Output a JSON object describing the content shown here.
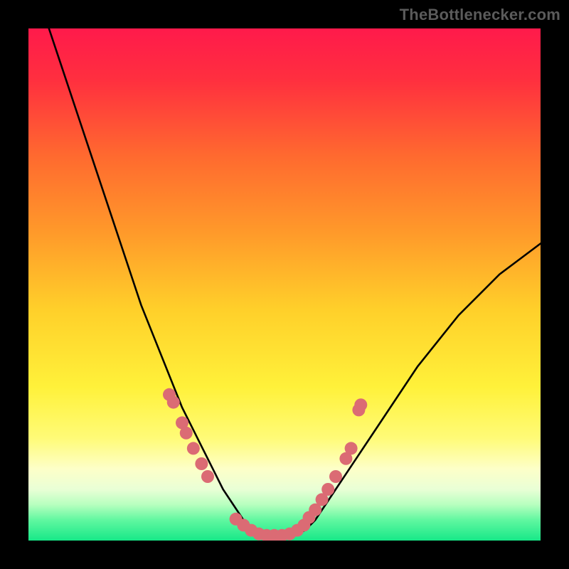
{
  "watermark": "TheBottlenecker.com",
  "chart_data": {
    "type": "line",
    "title": "",
    "xlabel": "",
    "ylabel": "",
    "xlim": [
      0,
      100
    ],
    "ylim": [
      0,
      100
    ],
    "grid": false,
    "legend": false,
    "background_gradient_stops": [
      {
        "offset": 0.0,
        "color": "#ff1a4b"
      },
      {
        "offset": 0.1,
        "color": "#ff2f3f"
      },
      {
        "offset": 0.25,
        "color": "#ff6a2f"
      },
      {
        "offset": 0.4,
        "color": "#ff9a2a"
      },
      {
        "offset": 0.55,
        "color": "#ffd02a"
      },
      {
        "offset": 0.7,
        "color": "#fff13a"
      },
      {
        "offset": 0.8,
        "color": "#fffb77"
      },
      {
        "offset": 0.86,
        "color": "#fdffc8"
      },
      {
        "offset": 0.9,
        "color": "#e9ffd6"
      },
      {
        "offset": 0.93,
        "color": "#b7ffbf"
      },
      {
        "offset": 0.96,
        "color": "#60f7a0"
      },
      {
        "offset": 1.0,
        "color": "#17e888"
      }
    ],
    "series": [
      {
        "name": "bottleneck-curve",
        "color": "#000000",
        "stroke_width": 2.6,
        "x": [
          4,
          6,
          8,
          10,
          12,
          14,
          16,
          18,
          20,
          22,
          24,
          26,
          28,
          30,
          32,
          34,
          36,
          38,
          40,
          42,
          44,
          46,
          48,
          50,
          52,
          54,
          56,
          58,
          60,
          64,
          68,
          72,
          76,
          80,
          84,
          88,
          92,
          96,
          100
        ],
        "y": [
          100,
          94,
          88,
          82,
          76,
          70,
          64,
          58,
          52,
          46,
          41,
          36,
          31,
          26,
          22,
          18,
          14,
          10,
          7,
          4,
          2,
          1,
          0.5,
          0.5,
          1,
          2,
          4,
          7,
          10,
          16,
          22,
          28,
          34,
          39,
          44,
          48,
          52,
          55,
          58
        ]
      },
      {
        "name": "highlight-dots-left",
        "color": "#db6b74",
        "marker_radius": 9,
        "x": [
          27.5,
          28.3,
          30.0,
          30.8,
          32.2,
          33.8,
          35.0
        ],
        "y": [
          28.5,
          27.0,
          23.0,
          21.0,
          18.0,
          15.0,
          12.5
        ]
      },
      {
        "name": "highlight-dots-bottom",
        "color": "#db6b74",
        "marker_radius": 9,
        "x": [
          40.5,
          42.0,
          43.5,
          45.0,
          46.5,
          48.0,
          49.5,
          51.0,
          52.5,
          53.8
        ],
        "y": [
          4.2,
          3.0,
          2.0,
          1.3,
          1.0,
          1.0,
          1.0,
          1.3,
          2.0,
          3.0
        ]
      },
      {
        "name": "highlight-dots-right",
        "color": "#db6b74",
        "marker_radius": 9,
        "x": [
          54.8,
          56.0,
          57.3,
          58.5,
          60.0,
          62.0,
          63.0
        ],
        "y": [
          4.5,
          6.0,
          8.0,
          10.0,
          12.5,
          16.0,
          18.0
        ]
      },
      {
        "name": "highlight-dots-outlier",
        "color": "#db6b74",
        "marker_radius": 9,
        "x": [
          64.5,
          64.9
        ],
        "y": [
          25.5,
          26.5
        ]
      }
    ]
  }
}
